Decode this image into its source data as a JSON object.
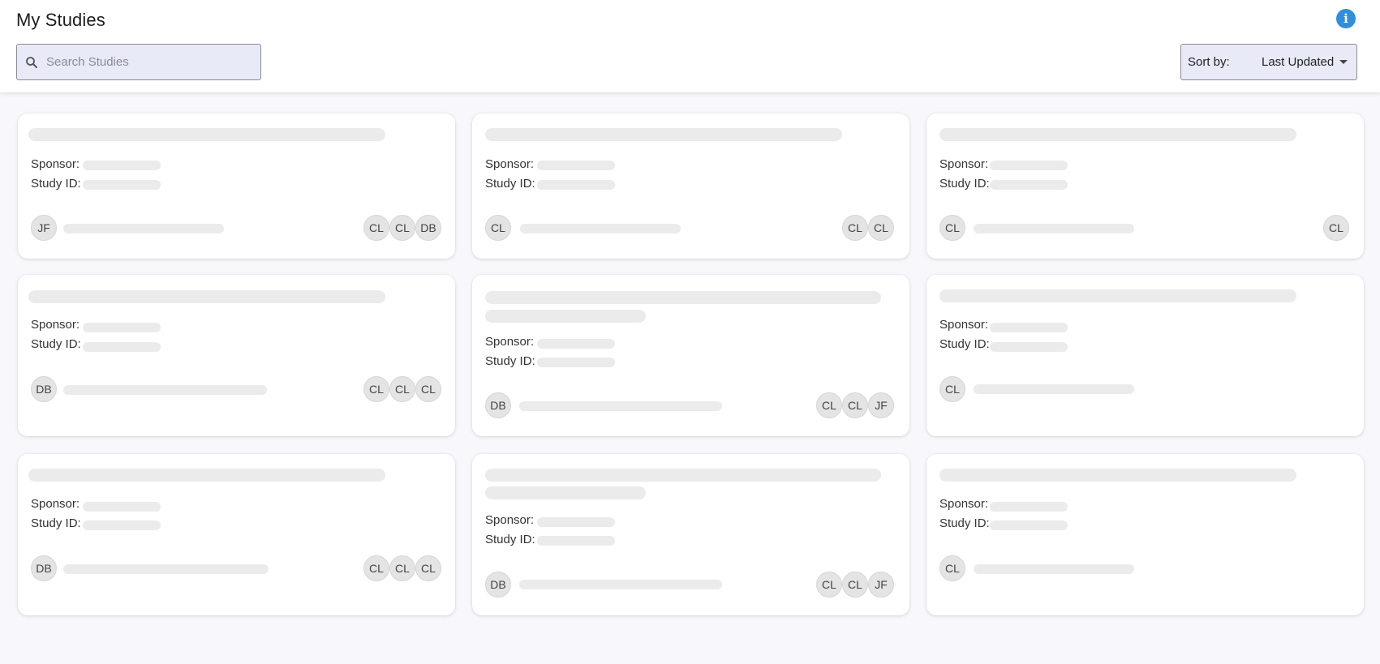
{
  "header": {
    "title": "My Studies",
    "search_placeholder": "Search Studies",
    "sort_label": "Sort by:",
    "sort_value": "Last Updated"
  },
  "labels": {
    "sponsor": "Sponsor:",
    "study_id": "Study ID:"
  },
  "colors": {
    "info_icon": "#2f8fde",
    "control_bg": "#e8eaf7",
    "skeleton": "#ebebeb"
  },
  "cards": [
    {
      "owner": "JF",
      "members": [
        "CL",
        "CL",
        "DB"
      ]
    },
    {
      "owner": "CL",
      "members": [
        "CL",
        "CL"
      ]
    },
    {
      "owner": "CL",
      "members": [
        "CL"
      ]
    },
    {
      "owner": "DB",
      "members": [
        "CL",
        "CL",
        "CL"
      ]
    },
    {
      "owner": "DB",
      "members": [
        "CL",
        "CL",
        "JF"
      ]
    },
    {
      "owner": "CL",
      "members": []
    },
    {
      "owner": "DB",
      "members": [
        "CL",
        "CL",
        "CL"
      ]
    },
    {
      "owner": "DB",
      "members": [
        "CL",
        "CL",
        "JF"
      ]
    },
    {
      "owner": "CL",
      "members": []
    }
  ]
}
